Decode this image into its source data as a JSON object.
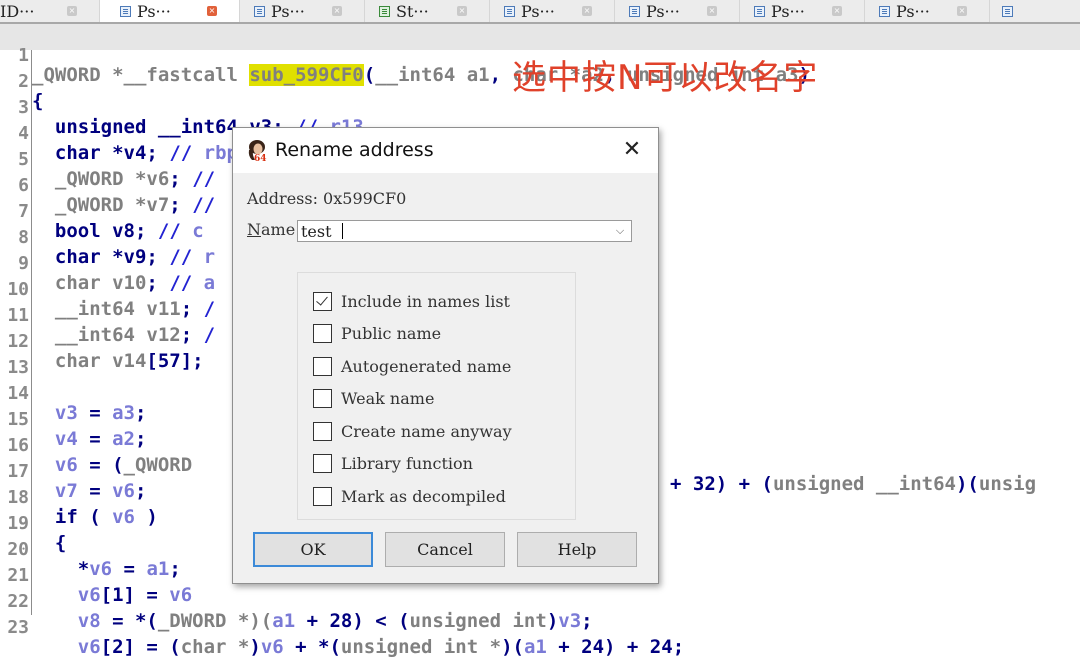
{
  "tabs": [
    {
      "label": "ID···",
      "icon": "ida-view-icon",
      "active": false
    },
    {
      "label": "Ps···",
      "icon": "pseudocode-icon",
      "active": true
    },
    {
      "label": "Ps···",
      "icon": "pseudocode-icon",
      "active": false
    },
    {
      "label": "St···",
      "icon": "structures-icon",
      "active": false
    },
    {
      "label": "Ps···",
      "icon": "pseudocode-icon",
      "active": false
    },
    {
      "label": "Ps···",
      "icon": "pseudocode-icon",
      "active": false
    },
    {
      "label": "Ps···",
      "icon": "pseudocode-icon",
      "active": false
    },
    {
      "label": "Ps···",
      "icon": "pseudocode-icon",
      "active": false
    },
    {
      "label": "",
      "icon": "window-icon",
      "active": false
    }
  ],
  "close_glyph": "×",
  "annotation": "选中按N可以改名字",
  "code": {
    "line_numbers": [
      "1",
      "2",
      "3",
      "4",
      "5",
      "6",
      "7",
      "8",
      "9",
      "10",
      "11",
      "12",
      "13",
      "14",
      "15",
      "16",
      "17",
      "18",
      "19",
      "20",
      "21",
      "22",
      "23"
    ],
    "line1": {
      "pre": "_QWORD *__fastcall ",
      "selected": "sub_599CF0",
      "paren": "(",
      "args1": "__int64 a1",
      "comma1": ", ",
      "args2": "char *a2",
      "comma2": ", ",
      "args3": "unsigned int a3",
      "close": ")"
    },
    "line2": "{",
    "line3": {
      "type": "unsigned __int64 ",
      "var": "v3",
      "semi": "; ",
      "cm": "// ",
      "reg": "r13"
    },
    "line4": {
      "type": "char *",
      "var": "v4",
      "semi": "; ",
      "cm": "// ",
      "reg": "rbp"
    },
    "line5": {
      "type": "_QWORD *",
      "var": "v6",
      "semi": "; ",
      "cm": "//"
    },
    "line6": {
      "type": "_QWORD *",
      "var": "v7",
      "semi": "; ",
      "cm": "//"
    },
    "line7": {
      "type": "bool ",
      "var": "v8",
      "semi": "; ",
      "cm": "// ",
      "reg": "c"
    },
    "line8": {
      "type": "char *",
      "var": "v9",
      "semi": "; ",
      "cm": "// ",
      "reg": "r"
    },
    "line9": {
      "type": "char ",
      "var": "v10",
      "semi": "; ",
      "cm": "// ",
      "reg": "a"
    },
    "line10": {
      "type": "__int64 ",
      "var": "v11",
      "semi": "; ",
      "cm": "/"
    },
    "line11": {
      "type": "__int64 ",
      "var": "v12",
      "semi": "; ",
      "cm": "/"
    },
    "line12": {
      "type": "char ",
      "var": "v14",
      "br": "[57];"
    },
    "line14": {
      "a": "v3",
      "op": " = ",
      "b": "a3",
      "end": ";"
    },
    "line15": {
      "a": "v4",
      "op": " = ",
      "b": "a2",
      "end": ";"
    },
    "line16": {
      "a": "v6",
      "op": " = (",
      "cast": "_QWORD",
      "tail_a": "+ 32) + (",
      "tail_cast": "unsigned __int64",
      "tail_b": ")(",
      "tail_c": "unsig"
    },
    "line17": {
      "a": "v7",
      "op": " = ",
      "b": "v6",
      "end": ";"
    },
    "line18": {
      "kw": "if ( ",
      "a": "v6",
      "end": " )"
    },
    "line19": "{",
    "line20": {
      "pre": "*",
      "a": "v6",
      "op": " = ",
      "b": "a1",
      "end": ";"
    },
    "line21": {
      "a": "v6",
      "br": "[1] = ",
      "b": "v6"
    },
    "line22": {
      "a": "v8",
      "op": " = *(",
      "cast": "_DWORD *)(",
      "b": "a1",
      "c": " + 28) < (",
      "cast2": "unsigned int",
      "d": ")",
      "e": "v3",
      "end": ";"
    },
    "line23": {
      "a": "v6",
      "br": "[2] = (",
      "cast": "char *",
      "b": ")",
      "c": "v6",
      "d": " + *(",
      "cast2": "unsigned int *",
      "e": ")(",
      "f": "a1",
      "g": " + 24) + 24;"
    }
  },
  "dialog": {
    "title": "Rename address",
    "close_glyph": "✕",
    "address_label": "Address: 0x599CF0",
    "name_label_mnemonic": "N",
    "name_label_rest": "ame",
    "name_value": "test",
    "dropdown_glyph": "⌵",
    "options": [
      {
        "label": "Include in names list",
        "checked": true
      },
      {
        "label": "Public name",
        "checked": false
      },
      {
        "label": "Autogenerated name",
        "checked": false
      },
      {
        "label": "Weak name",
        "checked": false
      },
      {
        "label": "Create name anyway",
        "checked": false
      },
      {
        "label": "Library function",
        "checked": false
      },
      {
        "label": "Mark as decompiled",
        "checked": false
      }
    ],
    "buttons": {
      "ok": "OK",
      "cancel": "Cancel",
      "help": "Help"
    }
  }
}
